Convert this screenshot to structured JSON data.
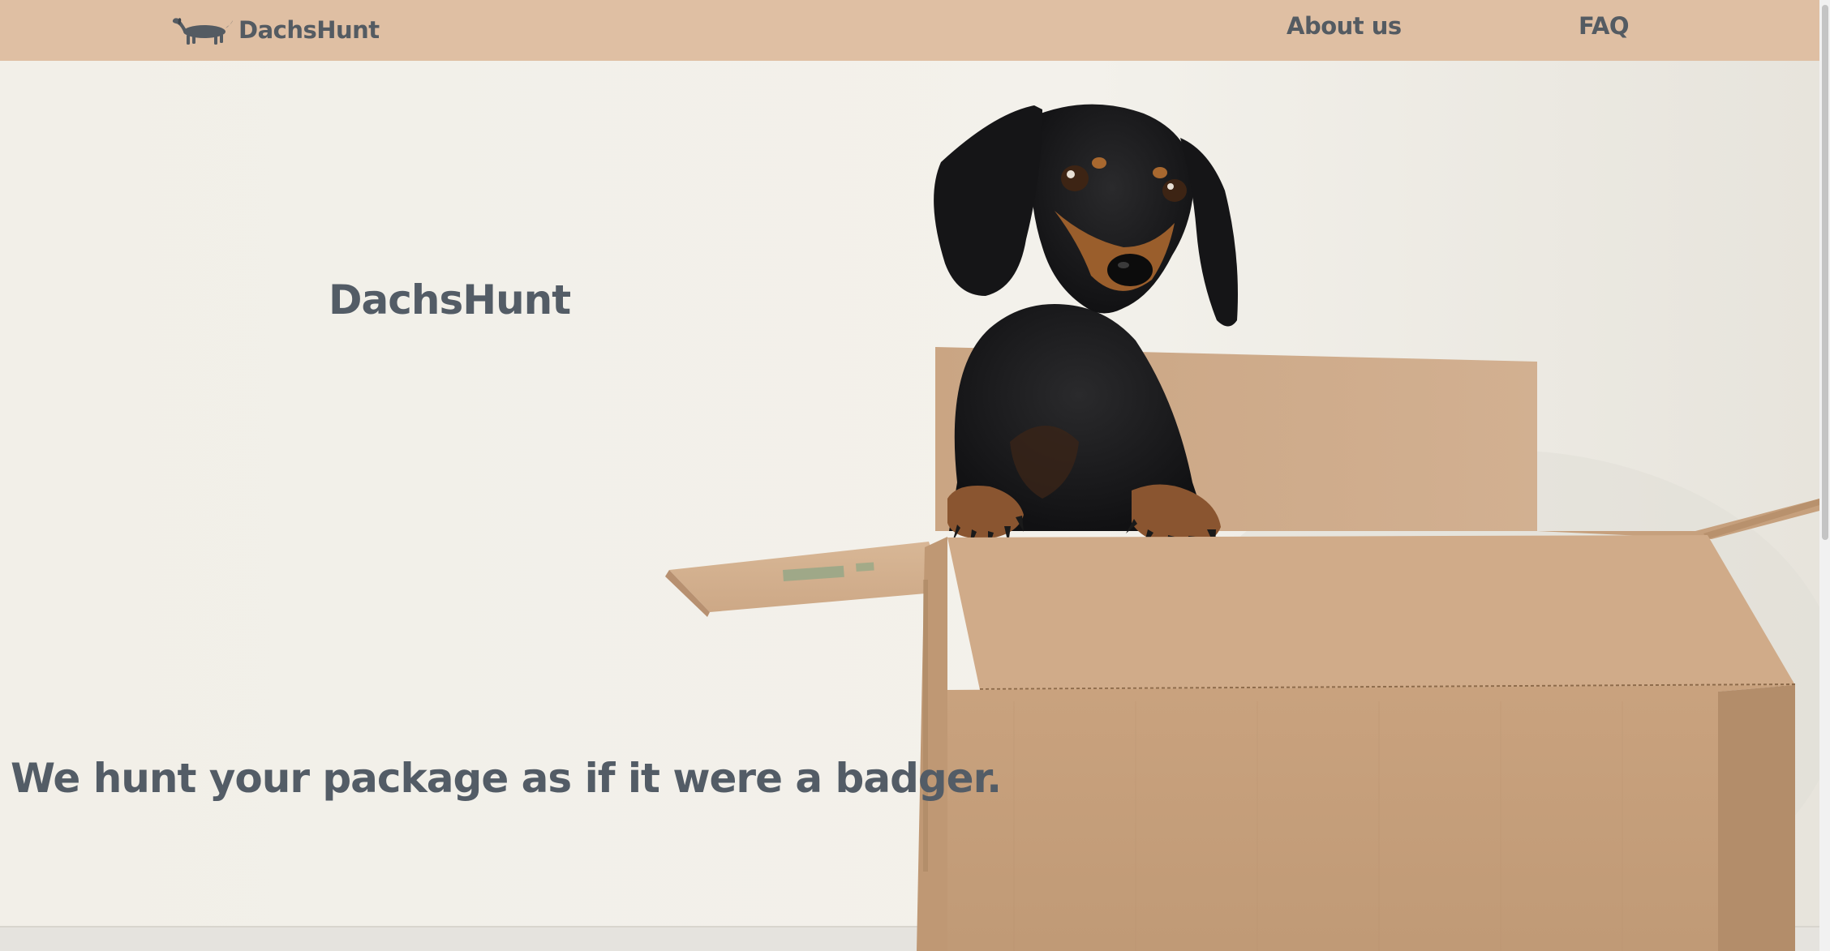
{
  "navbar": {
    "brand": {
      "label": "DachsHunt",
      "logo_icon": "dachshund-icon"
    },
    "links": [
      {
        "label": "About us"
      },
      {
        "label": "FAQ"
      }
    ],
    "background_color": "#dfbfa3",
    "text_color": "#545b62"
  },
  "hero": {
    "title": "DachsHunt",
    "tagline": "We hunt your package as if it were a badger.",
    "image": "dachshund-in-cardboard-box",
    "text_color": "#535c66"
  }
}
